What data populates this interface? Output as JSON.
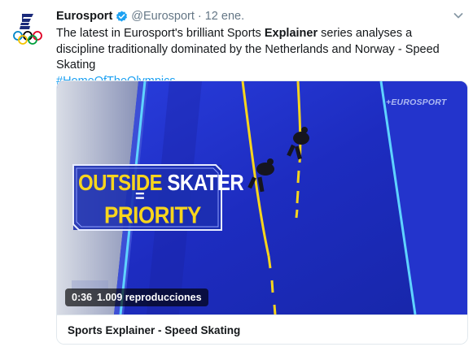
{
  "tweet": {
    "author_name": "Eurosport",
    "handle": "@Eurosport",
    "separator": "·",
    "time": "12 ene.",
    "text_part1": "The latest in Eurosport's brilliant Sports ",
    "text_bold": "Explainer",
    "text_part2": " series analyses a discipline traditionally dominated by the Netherlands and Norway - Speed Skating",
    "hashtag": "#HomeOfTheOlympics"
  },
  "video": {
    "duration": "0:36",
    "views": "1.009 reproducciones",
    "watermark": "+EUROSPORT",
    "graphic_word1": "OUTSIDE",
    "graphic_word2": " SKATER",
    "graphic_equals": "=",
    "graphic_word3": "PRIORITY"
  },
  "card": {
    "title": "Sports Explainer - Speed Skating"
  },
  "colors": {
    "hashtag": "#1da1f2",
    "verified": "#1da1f2",
    "graphic_yellow": "#f7d51d",
    "rink_blue": "#1f2fc4"
  },
  "icons": {
    "avatar": "eurosport-olympic-rings-logo",
    "verified": "verified-badge-icon",
    "caret": "chevron-down-icon"
  }
}
